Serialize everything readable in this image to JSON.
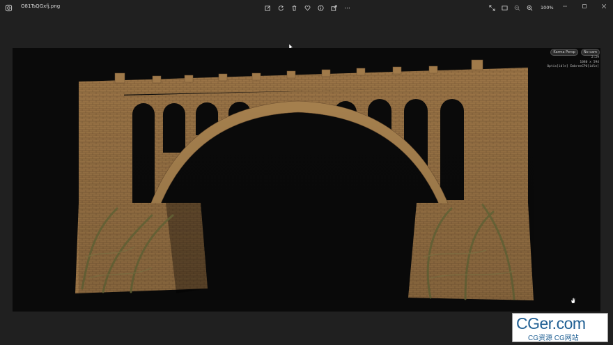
{
  "window": {
    "file_name": "O81TsQGxfj.png",
    "zoom_level": "100%"
  },
  "toolbar": {
    "center_icons": [
      "edit-image-icon",
      "rotate-icon",
      "delete-icon",
      "favorite-icon",
      "info-icon",
      "share-icon",
      "more-icon"
    ],
    "right_icons": [
      "fullscreen-icon",
      "fit-window-icon",
      "zoom-out-icon",
      "zoom-in-icon"
    ]
  },
  "viewport": {
    "renderer_pill": "Karma Persp",
    "camera_pill": "No cam",
    "stats": {
      "time": "2:29",
      "resolution": "1080 x 594",
      "engine_status": "Optix[idle] EmbreeCPU[idle]"
    }
  },
  "watermark": {
    "main": "CGer.com",
    "sub": "CG资源 CG网站"
  },
  "colors": {
    "background": "#202020",
    "viewer": "#0a0a0a",
    "brick": "#9a7446",
    "moss": "#6b6a3a",
    "watermark_text": "#1f5f93"
  }
}
